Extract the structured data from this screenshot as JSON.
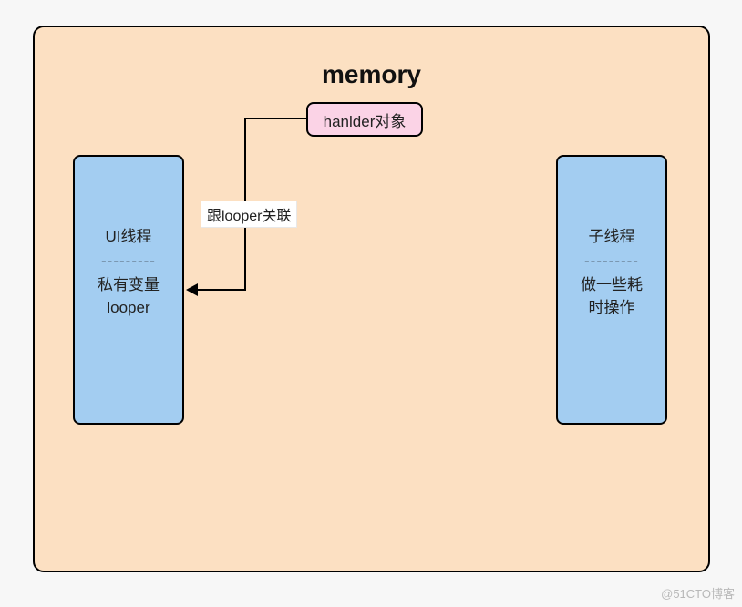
{
  "title": "memory",
  "handler": {
    "label": "hanlder对象"
  },
  "edge": {
    "label": "跟looper关联"
  },
  "ui_thread": {
    "line1": "UI线程",
    "divider": "---------",
    "line2": "私有变量",
    "line3": "looper"
  },
  "child_thread": {
    "line1": "子线程",
    "divider": "---------",
    "line2": "做一些耗",
    "line3": "时操作"
  },
  "watermark": "@51CTO博客"
}
